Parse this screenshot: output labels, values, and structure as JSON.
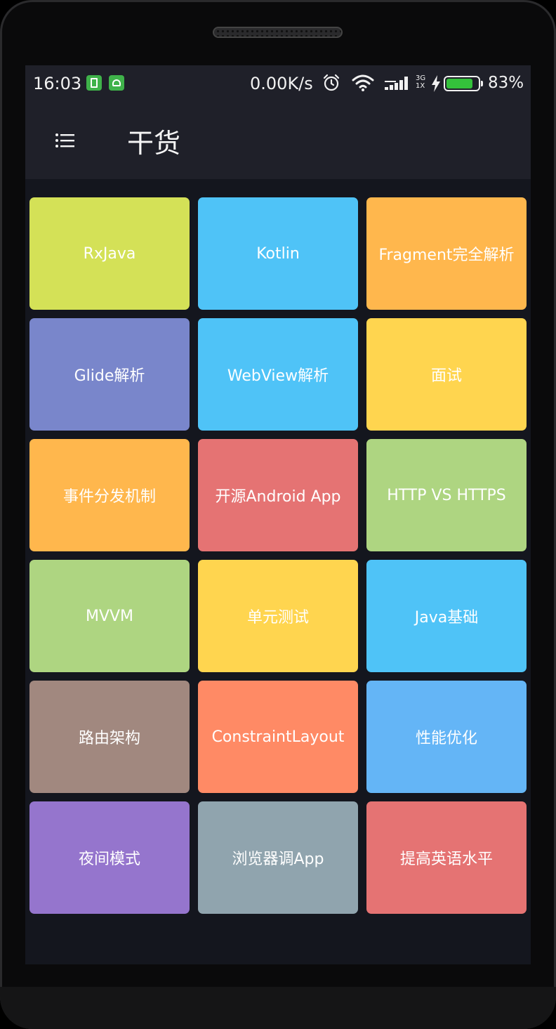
{
  "status_bar": {
    "time": "16:03",
    "net_speed": "0.00K/s",
    "net_type_top": "3G",
    "net_type_bottom": "1X",
    "battery_percent_label": "83%",
    "battery_level": 0.83,
    "colors": {
      "battery_fill": "#34c23b",
      "notif_icon_bg": "#3fb24a"
    }
  },
  "toolbar": {
    "title": "干货"
  },
  "tiles": [
    {
      "label": "RxJava",
      "color": "#d4e157"
    },
    {
      "label": "Kotlin",
      "color": "#4fc3f7"
    },
    {
      "label": "Fragment完全解析",
      "color": "#ffb74d"
    },
    {
      "label": "Glide解析",
      "color": "#7986cb"
    },
    {
      "label": "WebView解析",
      "color": "#4fc3f7"
    },
    {
      "label": "面试",
      "color": "#ffd54f"
    },
    {
      "label": "事件分发机制",
      "color": "#ffb74d"
    },
    {
      "label": "开源Android App",
      "color": "#e57373"
    },
    {
      "label": "HTTP VS HTTPS",
      "color": "#aed581"
    },
    {
      "label": "MVVM",
      "color": "#aed581"
    },
    {
      "label": "单元测试",
      "color": "#ffd54f"
    },
    {
      "label": "Java基础",
      "color": "#4fc3f7"
    },
    {
      "label": "路由架构",
      "color": "#a1887f"
    },
    {
      "label": "ConstraintLayout",
      "color": "#ff8a65"
    },
    {
      "label": "性能优化",
      "color": "#64b5f6"
    },
    {
      "label": "夜间模式",
      "color": "#9575cd"
    },
    {
      "label": "浏览器调App",
      "color": "#90a4ae"
    },
    {
      "label": "提高英语水平",
      "color": "#e57373"
    }
  ]
}
